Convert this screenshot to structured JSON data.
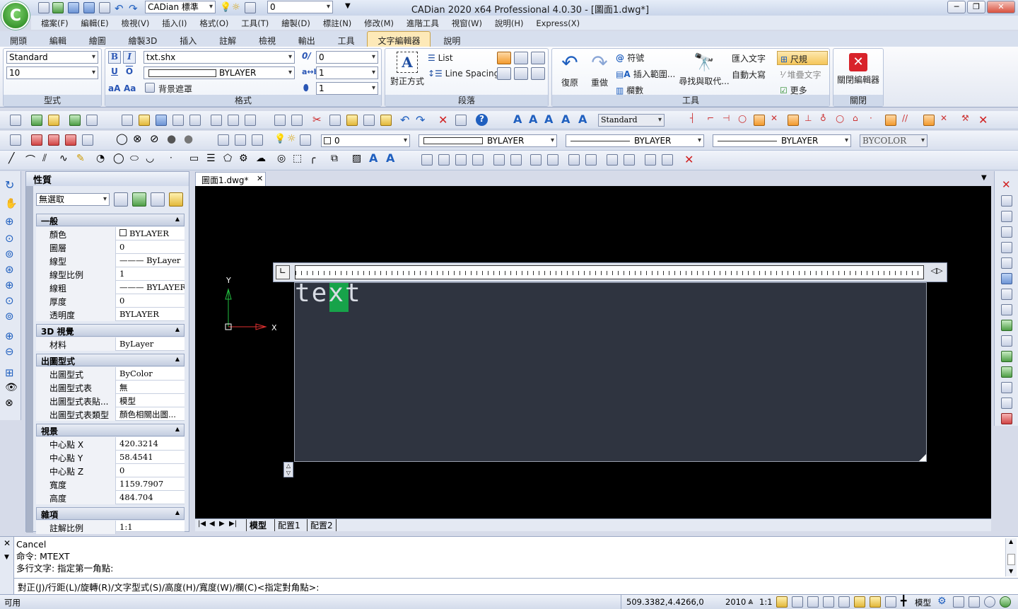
{
  "app": {
    "title": "CADian 2020 x64 Professional 4.0.30 - [圖面1.dwg*]",
    "logo_letter": "C",
    "qa_style_combo": "CADian 標準",
    "qa_layer_combo": "0",
    "window_buttons": [
      "─",
      "❐",
      "✕"
    ]
  },
  "menu": [
    "檔案(F)",
    "編輯(E)",
    "檢視(V)",
    "插入(I)",
    "格式(O)",
    "工具(T)",
    "繪製(D)",
    "標註(N)",
    "修改(M)",
    "進階工具",
    "視窗(W)",
    "說明(H)",
    "Express(X)"
  ],
  "tabs": [
    "開頭",
    "編輯",
    "繪圖",
    "繪製3D",
    "插入",
    "註解",
    "檢視",
    "輸出",
    "工具",
    "文字編輯器",
    "說明"
  ],
  "active_tab": "文字編輯器",
  "ribbon": {
    "style": {
      "label": "型式",
      "style_combo": "Standard",
      "height_combo": "10"
    },
    "format": {
      "label": "格式",
      "bold": "B",
      "italic": "I",
      "underline": "U",
      "overline": "O",
      "font_combo": "txt.shx",
      "color_combo": "BYLAYER",
      "background_mask": "背景遮罩",
      "oblique_combo": "0",
      "tracking_combo": "1",
      "width_combo": "1"
    },
    "paragraph": {
      "label": "段落",
      "justify": "對正方式",
      "list": "List",
      "line_spacing": "Line Spacing"
    },
    "tools": {
      "label": "工具",
      "undo": "復原",
      "redo": "重做",
      "symbol": "符號",
      "insert_field": "插入範圍...",
      "columns": "欄數",
      "find_replace": "尋找與取代...",
      "import_text": "匯入文字",
      "autocaps": "自動大寫",
      "ruler": "尺規",
      "stack": "堆疊文字",
      "more": "更多"
    },
    "close": {
      "label": "關閉",
      "close_editor": "關閉編輯器"
    }
  },
  "toolbar2": {
    "text_style_combo": "Standard"
  },
  "toolbar3": {
    "layer_combo": "0",
    "color_combo": "BYLAYER",
    "linetype_combo": "BYLAYER",
    "lineweight_combo": "BYLAYER",
    "plotstyle_combo": "BYCOLOR"
  },
  "properties": {
    "title": "性質",
    "selection": "無選取",
    "sections": {
      "general": {
        "label": "一般",
        "rows": [
          {
            "k": "顏色",
            "v": "BYLAYER"
          },
          {
            "k": "圖層",
            "v": "0"
          },
          {
            "k": "線型",
            "v": "——— ByLayer"
          },
          {
            "k": "線型比例",
            "v": "1"
          },
          {
            "k": "線粗",
            "v": "——— BYLAYER"
          },
          {
            "k": "厚度",
            "v": "0"
          },
          {
            "k": "透明度",
            "v": "BYLAYER"
          }
        ]
      },
      "view3d": {
        "label": "3D 視覺",
        "rows": [
          {
            "k": "材料",
            "v": "ByLayer"
          }
        ]
      },
      "plot": {
        "label": "出圖型式",
        "rows": [
          {
            "k": "出圖型式",
            "v": "ByColor"
          },
          {
            "k": "出圖型式表",
            "v": "無"
          },
          {
            "k": "出圖型式表貼...",
            "v": "模型"
          },
          {
            "k": "出圖型式表類型",
            "v": "顏色相關出圖..."
          }
        ]
      },
      "view": {
        "label": "視景",
        "rows": [
          {
            "k": "中心點 X",
            "v": "420.3214"
          },
          {
            "k": "中心點 Y",
            "v": "58.4541"
          },
          {
            "k": "中心點 Z",
            "v": "0"
          },
          {
            "k": "寬度",
            "v": "1159.7907"
          },
          {
            "k": "高度",
            "v": "484.704"
          }
        ]
      },
      "misc": {
        "label": "雜項",
        "rows": [
          {
            "k": "註解比例",
            "v": "1:1"
          }
        ]
      }
    }
  },
  "drawing": {
    "tab_name": "圖面1.dwg*",
    "tab_close": "✕",
    "editor_text": "text",
    "axis_x": "X",
    "axis_y": "Y",
    "layout_tabs": [
      "模型",
      "配置1",
      "配置2"
    ],
    "active_layout": "模型"
  },
  "command": {
    "lines": [
      "Cancel",
      "命令: MTEXT",
      "多行文字: 指定第一角點:"
    ],
    "prompt": "對正(J)/行距(L)/旋轉(R)/文字型式(S)/高度(H)/寬度(W)/欄(C)<指定對角點>:"
  },
  "status": {
    "ready": "可用",
    "coords": "509.3382,4.4266,0",
    "version": "2010",
    "scale": "1:1",
    "model": "模型"
  }
}
